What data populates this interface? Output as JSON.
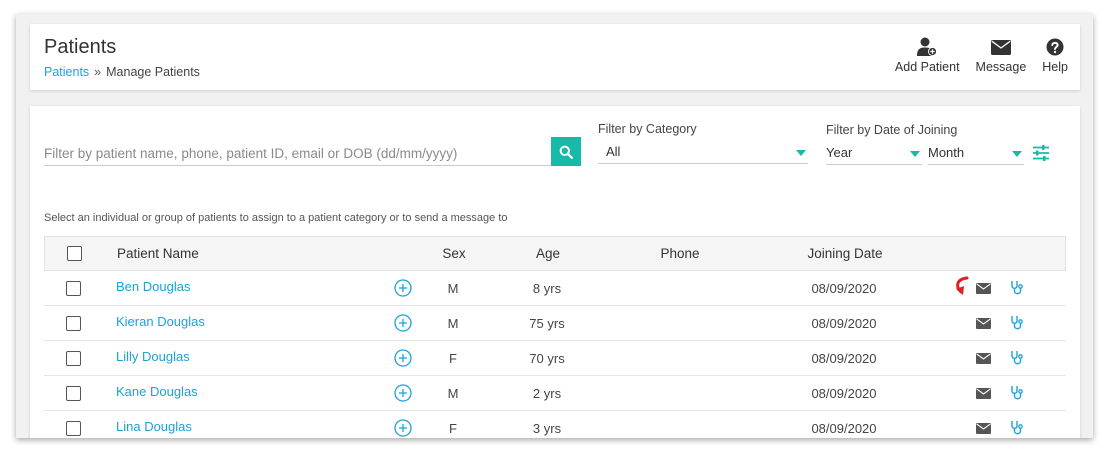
{
  "header": {
    "title": "Patients",
    "breadcrumb": {
      "link": "Patients",
      "separator": "»",
      "current": "Manage Patients"
    },
    "actions": [
      {
        "label": "Add Patient",
        "icon": "add-patient-icon"
      },
      {
        "label": "Message",
        "icon": "envelope-icon"
      },
      {
        "label": "Help",
        "icon": "help-icon"
      }
    ]
  },
  "filters": {
    "search_placeholder": "Filter by patient name, phone, patient ID, email or DOB (dd/mm/yyyy)",
    "search_value": "",
    "category_label": "Filter by Category",
    "category_value": "All",
    "date_label": "Filter by Date of Joining",
    "year_value": "Year",
    "month_value": "Month"
  },
  "hint": "Select an individual or group of patients to assign to a patient category or to send a message to",
  "table": {
    "columns": {
      "name": "Patient Name",
      "sex": "Sex",
      "age": "Age",
      "phone": "Phone",
      "joining": "Joining Date"
    },
    "rows": [
      {
        "name": "Ben Douglas",
        "sex": "M",
        "age": "8 yrs",
        "phone": "",
        "joining": "08/09/2020"
      },
      {
        "name": "Kieran Douglas",
        "sex": "M",
        "age": "75 yrs",
        "phone": "",
        "joining": "08/09/2020"
      },
      {
        "name": "Lilly Douglas",
        "sex": "F",
        "age": "70 yrs",
        "phone": "",
        "joining": "08/09/2020"
      },
      {
        "name": "Kane Douglas",
        "sex": "M",
        "age": "2 yrs",
        "phone": "",
        "joining": "08/09/2020"
      },
      {
        "name": "Lina Douglas",
        "sex": "F",
        "age": "3 yrs",
        "phone": "",
        "joining": "08/09/2020"
      }
    ]
  },
  "colors": {
    "accent": "#17b9a8",
    "link": "#1aa3d9",
    "annotation": "#e02020",
    "icon_dark": "#555555"
  }
}
